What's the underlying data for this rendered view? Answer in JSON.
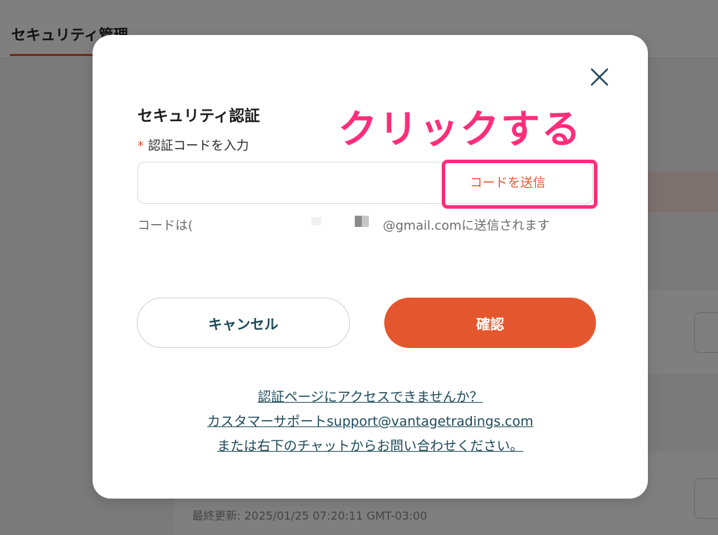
{
  "background": {
    "page_title": "セキュリティ管理",
    "last_updated": "最終更新: 2025/01/25 07:20:11 GMT-03:00"
  },
  "modal": {
    "title": "セキュリティ認証",
    "close_icon": "close-icon",
    "field": {
      "required_mark": "*",
      "label": "認証コードを入力",
      "value": "",
      "placeholder": ""
    },
    "send_code_label": "コードを送信",
    "hint_prefix": "コードは(",
    "hint_suffix": "@gmail.comに送信されます",
    "cancel_label": "キャンセル",
    "confirm_label": "確認",
    "help": {
      "line1": "認証ページにアクセスできませんか？",
      "line2": "カスタマーサポートsupport@vantagetradings.com",
      "line3": "または右下のチャットからお問い合わせください。"
    }
  },
  "annotation": {
    "text": "クリックする",
    "color": "#ff2d7a"
  },
  "colors": {
    "accent": "#e4572e",
    "link": "#1e4a5a",
    "annotation": "#ff2d7a"
  }
}
